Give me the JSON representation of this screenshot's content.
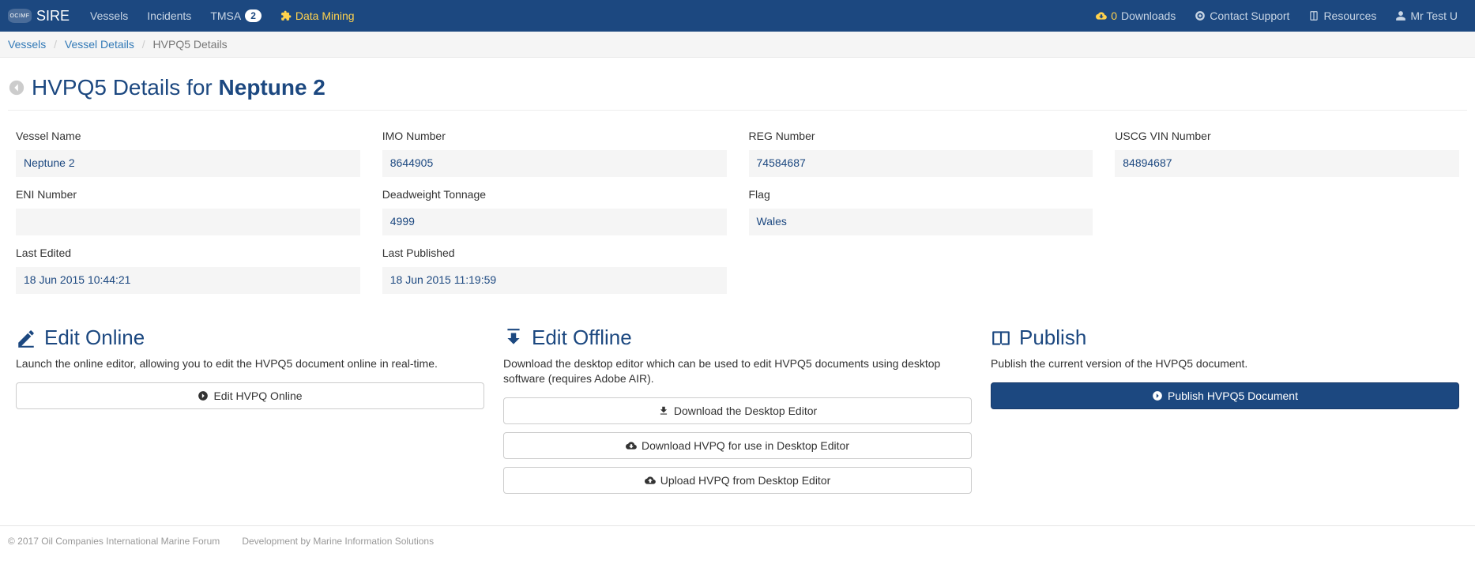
{
  "navbar": {
    "brand_logo": "OCIMF",
    "brand_name": "SIRE",
    "left": {
      "vessels": "Vessels",
      "incidents": "Incidents",
      "tmsa": "TMSA",
      "tmsa_badge": "2",
      "data_mining": "Data Mining"
    },
    "right": {
      "downloads_count": "0",
      "downloads_label": "Downloads",
      "contact": "Contact Support",
      "resources": "Resources",
      "user": "Mr Test U"
    }
  },
  "breadcrumb": {
    "vessels": "Vessels",
    "vessel_details": "Vessel Details",
    "current": "HVPQ5 Details"
  },
  "page_title": {
    "prefix": "HVPQ5 Details for ",
    "vessel": "Neptune 2"
  },
  "fields": {
    "vessel_name": {
      "label": "Vessel Name",
      "value": "Neptune 2"
    },
    "imo": {
      "label": "IMO Number",
      "value": "8644905"
    },
    "reg": {
      "label": "REG Number",
      "value": "74584687"
    },
    "uscg": {
      "label": "USCG VIN Number",
      "value": "84894687"
    },
    "eni": {
      "label": "ENI Number",
      "value": ""
    },
    "dwt": {
      "label": "Deadweight Tonnage",
      "value": "4999"
    },
    "flag": {
      "label": "Flag",
      "value": "Wales"
    },
    "last_edited": {
      "label": "Last Edited",
      "value": "18 Jun 2015 10:44:21"
    },
    "last_published": {
      "label": "Last Published",
      "value": "18 Jun 2015 11:19:59"
    }
  },
  "actions": {
    "edit_online": {
      "title": "Edit Online",
      "desc": "Launch the online editor, allowing you to edit the HVPQ5 document online in real-time.",
      "btn": "Edit HVPQ Online"
    },
    "edit_offline": {
      "title": "Edit Offline",
      "desc": "Download the desktop editor which can be used to edit HVPQ5 documents using desktop software (requires Adobe AIR).",
      "btn_download_editor": "Download the Desktop Editor",
      "btn_download_hvpq": "Download HVPQ for use in Desktop Editor",
      "btn_upload_hvpq": "Upload HVPQ from Desktop Editor"
    },
    "publish": {
      "title": "Publish",
      "desc": "Publish the current version of the HVPQ5 document.",
      "btn": "Publish HVPQ5 Document"
    }
  },
  "footer": {
    "copyright": "© 2017 Oil Companies International Marine Forum",
    "dev": "Development by Marine Information Solutions"
  }
}
